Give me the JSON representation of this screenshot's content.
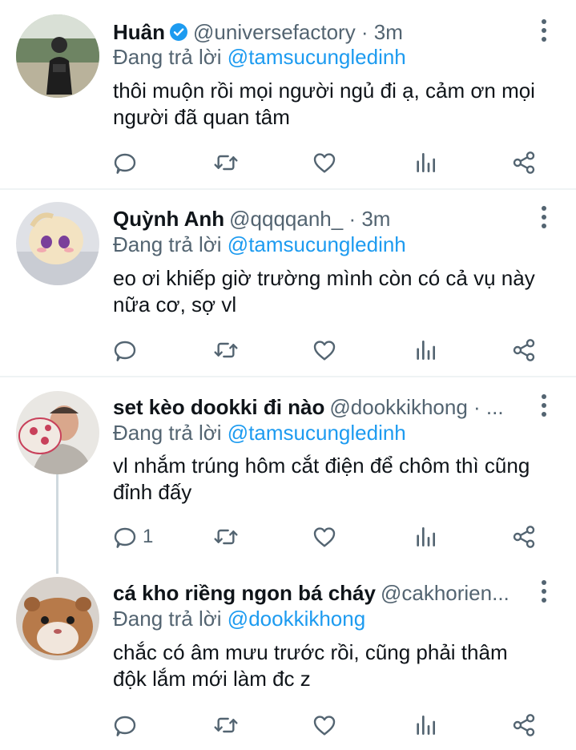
{
  "reply_prefix": "Đang trả lời",
  "colors": {
    "accent": "#1d9bf0",
    "secondary": "#536471",
    "text": "#0f1419",
    "divider": "#eff3f4"
  },
  "tweets": [
    {
      "name": "Huân",
      "verified": true,
      "handle_time": "@universefactory · 3m",
      "reply_to": "@tamsucungledinh",
      "text": "thôi muộn rồi mọi người ngủ đi ạ, cảm ơn mọi người đã quan tâm",
      "reply_count": ""
    },
    {
      "name": "Quỳnh Anh",
      "verified": false,
      "handle_time": "@qqqqanh_ · 3m",
      "reply_to": "@tamsucungledinh",
      "text": "eo ơi khiếp giờ trường mình còn có cả vụ này nữa cơ, sợ vl",
      "reply_count": ""
    },
    {
      "name": "set kèo dookki đi nào",
      "verified": false,
      "handle_time": "@dookkikhong · ...",
      "reply_to": "@tamsucungledinh",
      "text": "vl nhắm trúng hôm cắt điện để chôm thì cũng đỉnh đấy",
      "reply_count": "1"
    },
    {
      "name": "cá kho riềng ngon bá cháy",
      "verified": false,
      "handle_time": "@cakhorien...",
      "reply_to": "@dookkikhong",
      "text": "chắc có âm mưu trước rồi, cũng phải thâm độk lắm mới làm đc z",
      "reply_count": ""
    }
  ],
  "icons": [
    "reply-icon",
    "retweet-icon",
    "like-icon",
    "analytics-icon",
    "share-icon",
    "verified-badge-icon",
    "more-options-icon"
  ]
}
